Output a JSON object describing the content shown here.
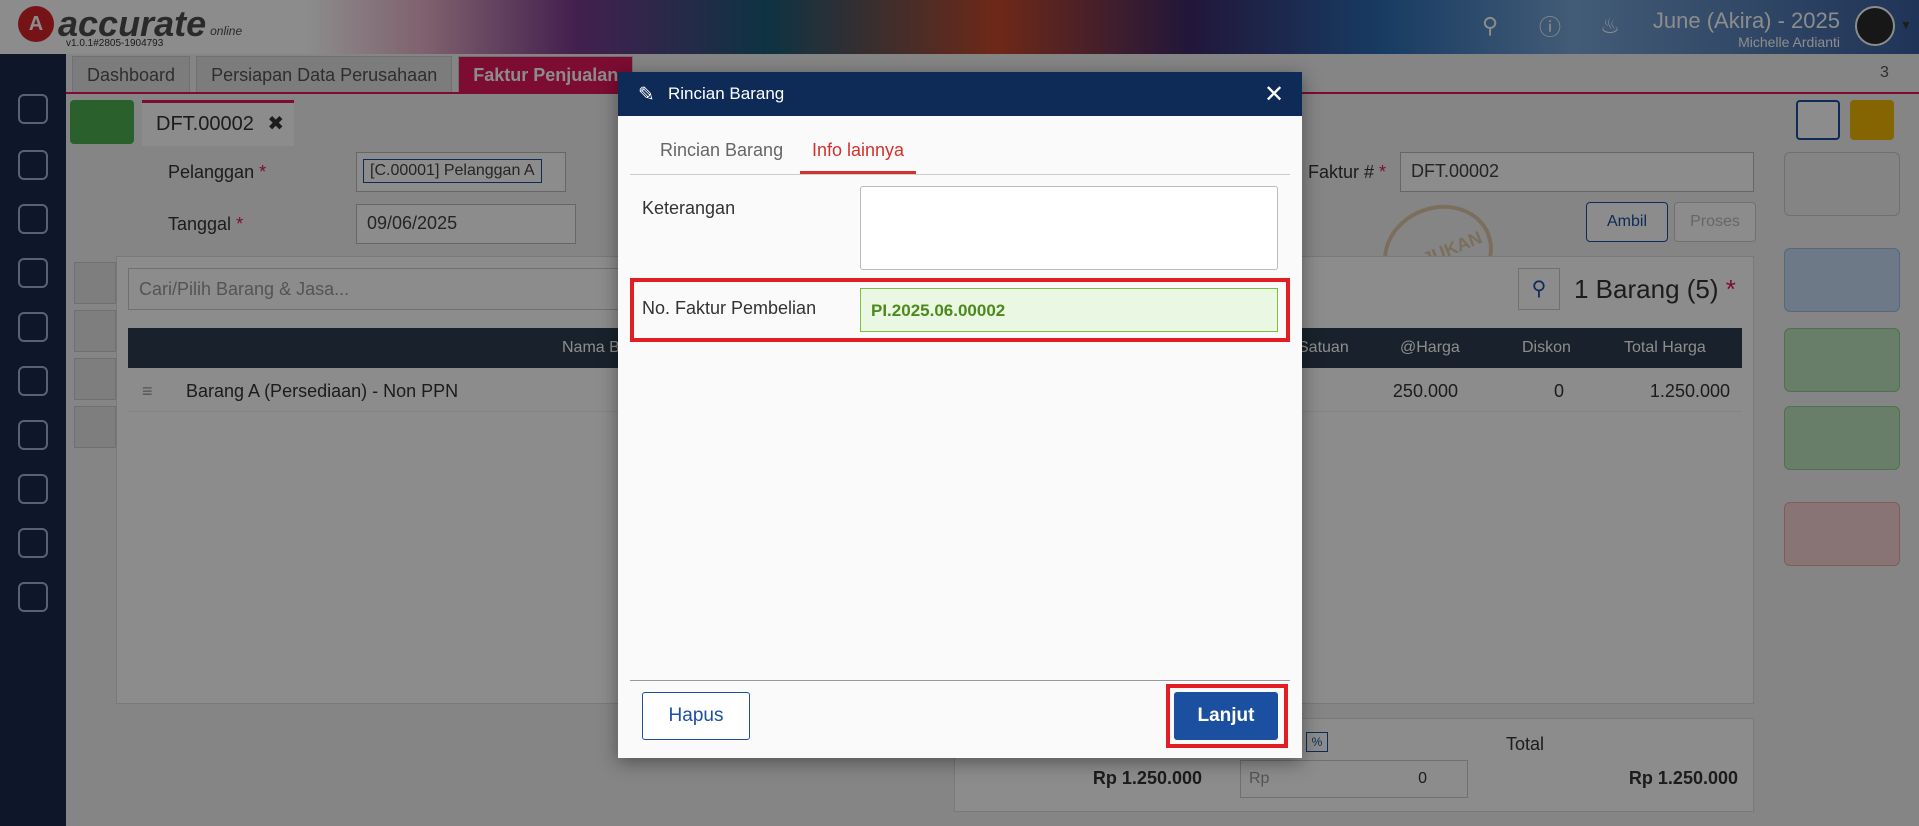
{
  "app": {
    "logo_text": "accurate",
    "logo_sub": "online",
    "version": "v1.0.1#2805-1904793",
    "user_name": "June (Akira) - 2025",
    "user_sub": "Michelle Ardianti"
  },
  "tabs": [
    {
      "label": "Dashboard"
    },
    {
      "label": "Persiapan Data Perusahaan"
    },
    {
      "label": "Faktur Penjualan"
    }
  ],
  "tab_count": "3",
  "doc_tab": {
    "label": "DFT.00002"
  },
  "form": {
    "pelanggan_label": "Pelanggan",
    "pelanggan_value": "[C.00001] Pelanggan A",
    "tanggal_label": "Tanggal",
    "tanggal_value": "09/06/2025",
    "faktur_label": "Faktur #",
    "faktur_value": "DFT.00002",
    "required_mark": "*",
    "ambil_label": "Ambil",
    "proses_label": "Proses",
    "search_placeholder": "Cari/Pilih Barang & Jasa...",
    "count_label": "1 Barang (5)",
    "stamp_text": "DIAJUKAN"
  },
  "table": {
    "headers": [
      "Nama B",
      "Satuan",
      "@Harga",
      "Diskon",
      "Total Harga"
    ],
    "rows": [
      {
        "nama": "Barang A (Persediaan) - Non PPN",
        "harga": "250.000",
        "diskon": "0",
        "total": "1.250.000"
      }
    ]
  },
  "footer": {
    "subtotal": "Rp 1.250.000",
    "disc_prefix": "Rp",
    "disc_value": "0",
    "pct": "%",
    "total_label": "Total",
    "total_value": "Rp 1.250.000"
  },
  "modal": {
    "title": "Rincian Barang",
    "close": "✕",
    "tabs": [
      {
        "label": "Rincian Barang"
      },
      {
        "label": "Info lainnya"
      }
    ],
    "keterangan_label": "Keterangan",
    "no_faktur_label": "No. Faktur Pembelian",
    "no_faktur_value": "PI.2025.06.00002",
    "hapus_label": "Hapus",
    "lanjut_label": "Lanjut"
  },
  "colors": {
    "accent": "#e3165b",
    "primary": "#1b4fa0",
    "highlight": "#e01e24",
    "sidebar": "#1a2b4d"
  }
}
